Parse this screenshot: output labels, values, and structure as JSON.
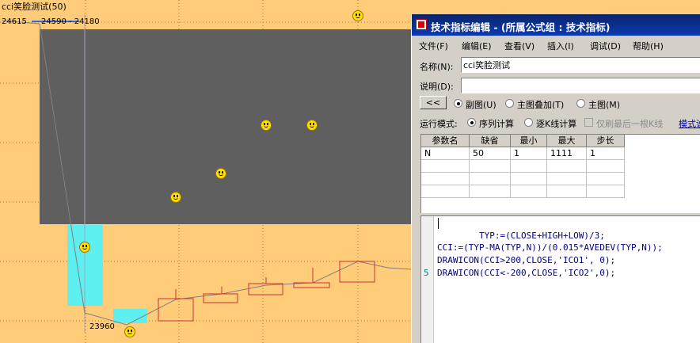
{
  "chart": {
    "title": "cci笑脸测试(50)",
    "price_labels": [
      "24615",
      "24590 - 24180",
      "23960"
    ]
  },
  "editor": {
    "title": "技术指标编辑 - (所属公式组 : 技术指标)",
    "menu": [
      "文件(F)",
      "编辑(E)",
      "查看(V)",
      "插入(I)",
      "调试(D)",
      "帮助(H)"
    ],
    "name_label": "名称(N):",
    "name_value": "cci笑脸测试",
    "desc_label": "说明(D):",
    "desc_value": "",
    "collapse_button": "<<",
    "chart_type_options": [
      "副图(U)",
      "主图叠加(T)",
      "主图(M)"
    ],
    "chart_type_selected": "副图(U)",
    "run_mode_label": "运行模式:",
    "run_mode_options": [
      "序列计算",
      "逐K线计算"
    ],
    "run_mode_selected": "序列计算",
    "last_bar_only": "仅刷最后一根K线",
    "mode_link": "模式说",
    "param_headers": [
      "参数名",
      "缺省",
      "最小",
      "最大",
      "步长"
    ],
    "param_rows": [
      [
        "N",
        "50",
        "1",
        "1111",
        "1"
      ]
    ],
    "line_number": "5",
    "code": [
      "        TYP:=(CLOSE+HIGH+LOW)/3;",
      "CCI:=(TYP-MA(TYP,N))/(0.015*AVEDEV(TYP,N));",
      "DRAWICON(CCI>200,CLOSE,'ICO1', 0);",
      "DRAWICON(CCI<-200,CLOSE,'ICO2',0);"
    ]
  },
  "colors": {
    "chart_bg": "#ffcc7a",
    "gray_block": "#5f5f5f",
    "cyan": "#5ef0f0",
    "candle": "#d03030",
    "titlebar": "#0a246a"
  },
  "icons": [
    "smiley-icon",
    "app-icon",
    "radio-icon",
    "checkbox-icon"
  ]
}
